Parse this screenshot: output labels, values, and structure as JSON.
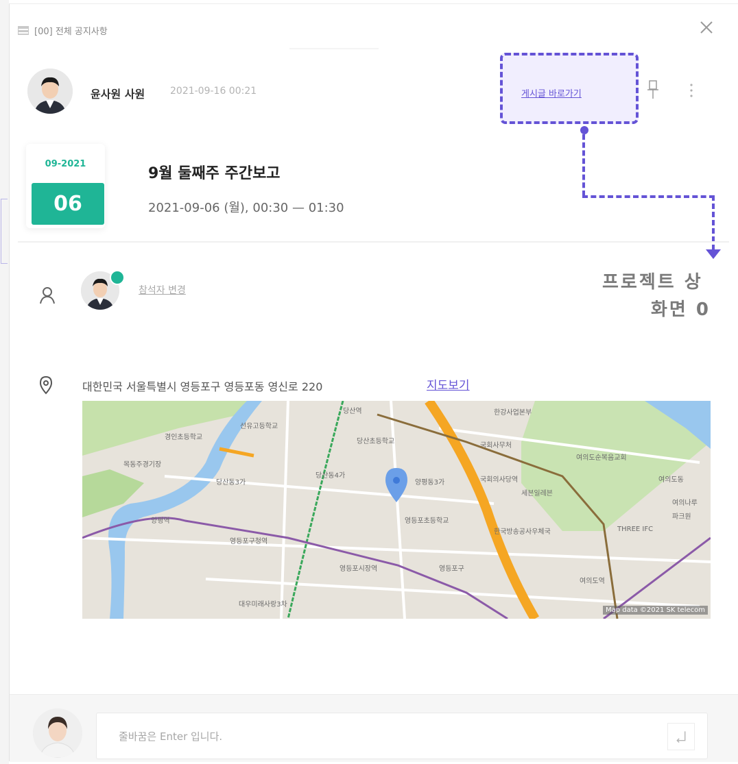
{
  "header": {
    "board_name": "[00] 전체 공지사항",
    "icons": {
      "board": "board-list-icon",
      "close": "close-icon"
    }
  },
  "post": {
    "author_name": "윤사원 사원",
    "author_date": "2021-09-16 00:21",
    "goto_label": "게시글 바로가기",
    "icons": {
      "pin": "pin-icon",
      "more": "more-vertical-icon"
    }
  },
  "event": {
    "month_year": "09-2021",
    "day": "06",
    "title": "9월 둘째주 주간보고",
    "time_range": "2021-09-06 (월), 00:30 — 01:30"
  },
  "participants": {
    "change_label": "참석자 변경",
    "icon": "person-icon"
  },
  "location": {
    "address": "대한민국 서울특별시 영등포구 영등포동 영신로 220",
    "map_link_label": "지도보기",
    "icon": "location-pin-icon",
    "map": {
      "credit": "Map data ©2021 SK telecom",
      "labels": {
        "l1": "당산역",
        "l2": "한강사업본부",
        "l3": "선유고등학교",
        "l4": "경인초등학교",
        "l5": "당산초등학교",
        "l6": "국회사무처",
        "l7": "여의도순복음교회",
        "l8": "목동주경기장",
        "l9": "국회의사당역",
        "l10": "여의도동",
        "l11": "당산동3가",
        "l12": "당산동4가",
        "l13": "양평동3가",
        "l14": "세븐일레븐",
        "l15": "영등포초등학교",
        "l16": "양평역",
        "l17": "영등포구청역",
        "l18": "한국방송공사우체국",
        "l19": "THREE IFC",
        "l20": "영등포시장역",
        "l21": "영등포구",
        "l22": "여의도역",
        "l23": "대우미래사랑3차",
        "l24": "파크원",
        "l25": "여의나루"
      }
    }
  },
  "annotation": {
    "line1": "프로젝트 상",
    "line2": "화면 0"
  },
  "comment": {
    "placeholder": "줄바꿈은 Enter 입니다.",
    "icon": "enter-icon"
  },
  "colors": {
    "accent_purple": "#6453d6",
    "accent_teal": "#1fb596",
    "map_water": "#99c7ee",
    "map_park": "#b6d99a",
    "map_highway": "#f5a623"
  }
}
